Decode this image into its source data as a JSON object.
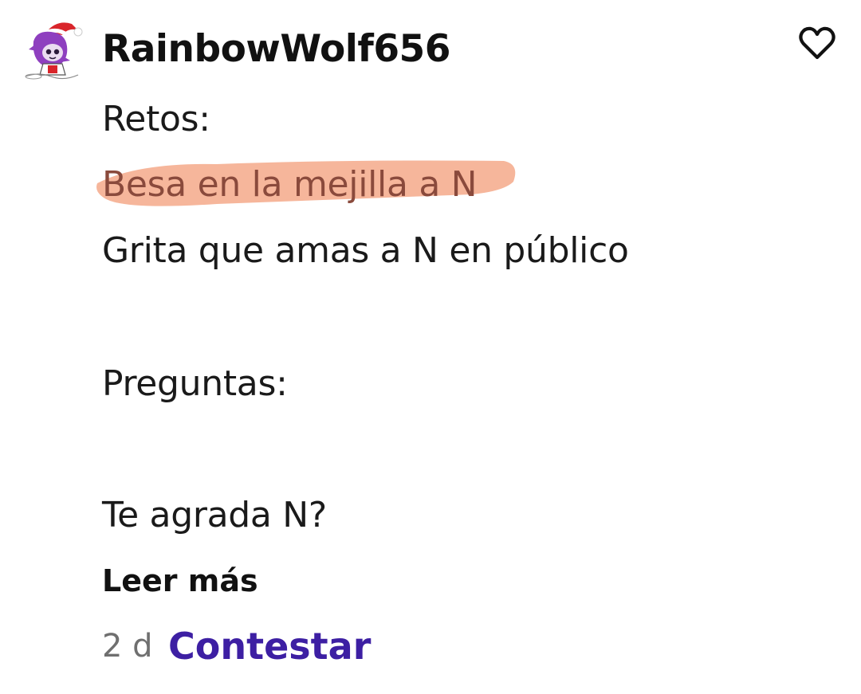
{
  "comment": {
    "username": "RainbowWolf656",
    "lines": [
      "Retos:",
      "Besa en la mejilla a N",
      "Grita que amas a N en público",
      "Preguntas:",
      "Te agrada N?"
    ],
    "highlight_color": "#f4a98a",
    "read_more": "Leer más",
    "timestamp": "2 d",
    "reply": "Contestar",
    "reply_color": "#3d1fa3",
    "like_icon": "heart-outline-icon",
    "avatar_icon": "avatar-character-santa-hat"
  }
}
